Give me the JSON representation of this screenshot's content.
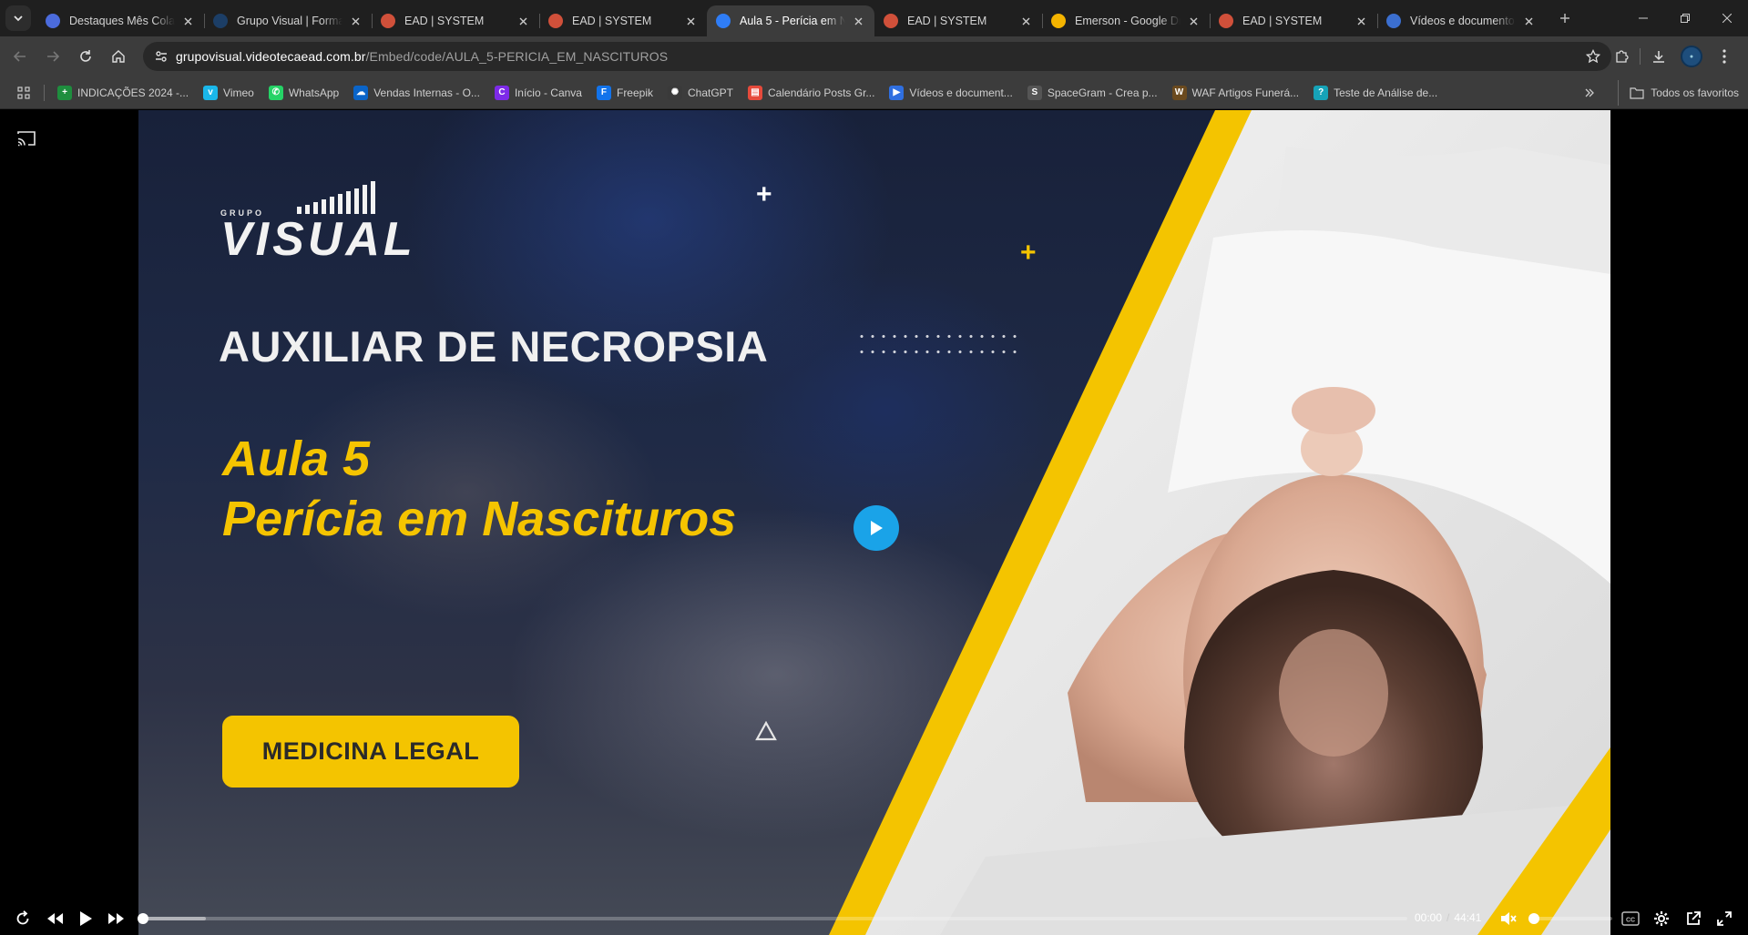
{
  "tabs": [
    {
      "title": "Destaques Mês Colab",
      "favicon_color": "#4b6bdc"
    },
    {
      "title": "Grupo Visual | Forma",
      "favicon_color": "#1c3e66"
    },
    {
      "title": "EAD | SYSTEM",
      "favicon_color": "#d0503a"
    },
    {
      "title": "EAD | SYSTEM",
      "favicon_color": "#d0503a"
    },
    {
      "title": "Aula 5 - Perícia em N",
      "favicon_color": "#2f7df6",
      "active": true
    },
    {
      "title": "EAD | SYSTEM",
      "favicon_color": "#d0503a"
    },
    {
      "title": "Emerson - Google Dr",
      "favicon_color": "#f4b400"
    },
    {
      "title": "EAD | SYSTEM",
      "favicon_color": "#d0503a"
    },
    {
      "title": "Vídeos e documento",
      "favicon_color": "#3b6fd0"
    }
  ],
  "address_bar": {
    "host": "grupovisual.videotecaead.com.br",
    "path": "/Embed/code/AULA_5-PERICIA_EM_NASCITUROS"
  },
  "bookmarks": [
    {
      "label": "INDICAÇÕES 2024 -...",
      "icon": "sheets-icon",
      "color": "#1e8e3e",
      "glyph": "+"
    },
    {
      "label": "Vimeo",
      "icon": "vimeo-icon",
      "color": "#1ab7ea",
      "glyph": "v"
    },
    {
      "label": "WhatsApp",
      "icon": "whatsapp-icon",
      "color": "#25d366",
      "glyph": "✆"
    },
    {
      "label": "Vendas Internas - O...",
      "icon": "onedrive-icon",
      "color": "#0a64c8",
      "glyph": "☁"
    },
    {
      "label": "Início - Canva",
      "icon": "canva-icon",
      "color": "#7d2ae8",
      "glyph": "C"
    },
    {
      "label": "Freepik",
      "icon": "freepik-icon",
      "color": "#1273eb",
      "glyph": "F"
    },
    {
      "label": "ChatGPT",
      "icon": "chatgpt-icon",
      "color": "#3a3a3a",
      "glyph": "✺"
    },
    {
      "label": "Calendário Posts Gr...",
      "icon": "calendar-icon",
      "color": "#e64a3b",
      "glyph": "▤"
    },
    {
      "label": "Vídeos e document...",
      "icon": "video-icon",
      "color": "#2f6fe0",
      "glyph": "▶"
    },
    {
      "label": "SpaceGram - Crea p...",
      "icon": "spacegram-icon",
      "color": "#555555",
      "glyph": "S"
    },
    {
      "label": "WAF Artigos Funerá...",
      "icon": "waf-icon",
      "color": "#6b4a1e",
      "glyph": "W"
    },
    {
      "label": "Teste de Análise de...",
      "icon": "test-icon",
      "color": "#16a3b8",
      "glyph": "?"
    }
  ],
  "bookmarks_all_label": "Todos os favoritos",
  "poster": {
    "logo_small": "GRUPO",
    "logo_big": "VISUAL",
    "course_title": "AUXILIAR DE NECROPSIA",
    "lesson_line1": "Aula 5",
    "lesson_line2": "Perícia em Nascituros",
    "category_badge": "MEDICINA LEGAL"
  },
  "player": {
    "current_time": "00:00",
    "separator": "/",
    "duration": "44:41",
    "progress_fraction": 0,
    "buffered_fraction": 0.05,
    "volume_fraction": 0,
    "accent_color": "#1aa3e8"
  }
}
